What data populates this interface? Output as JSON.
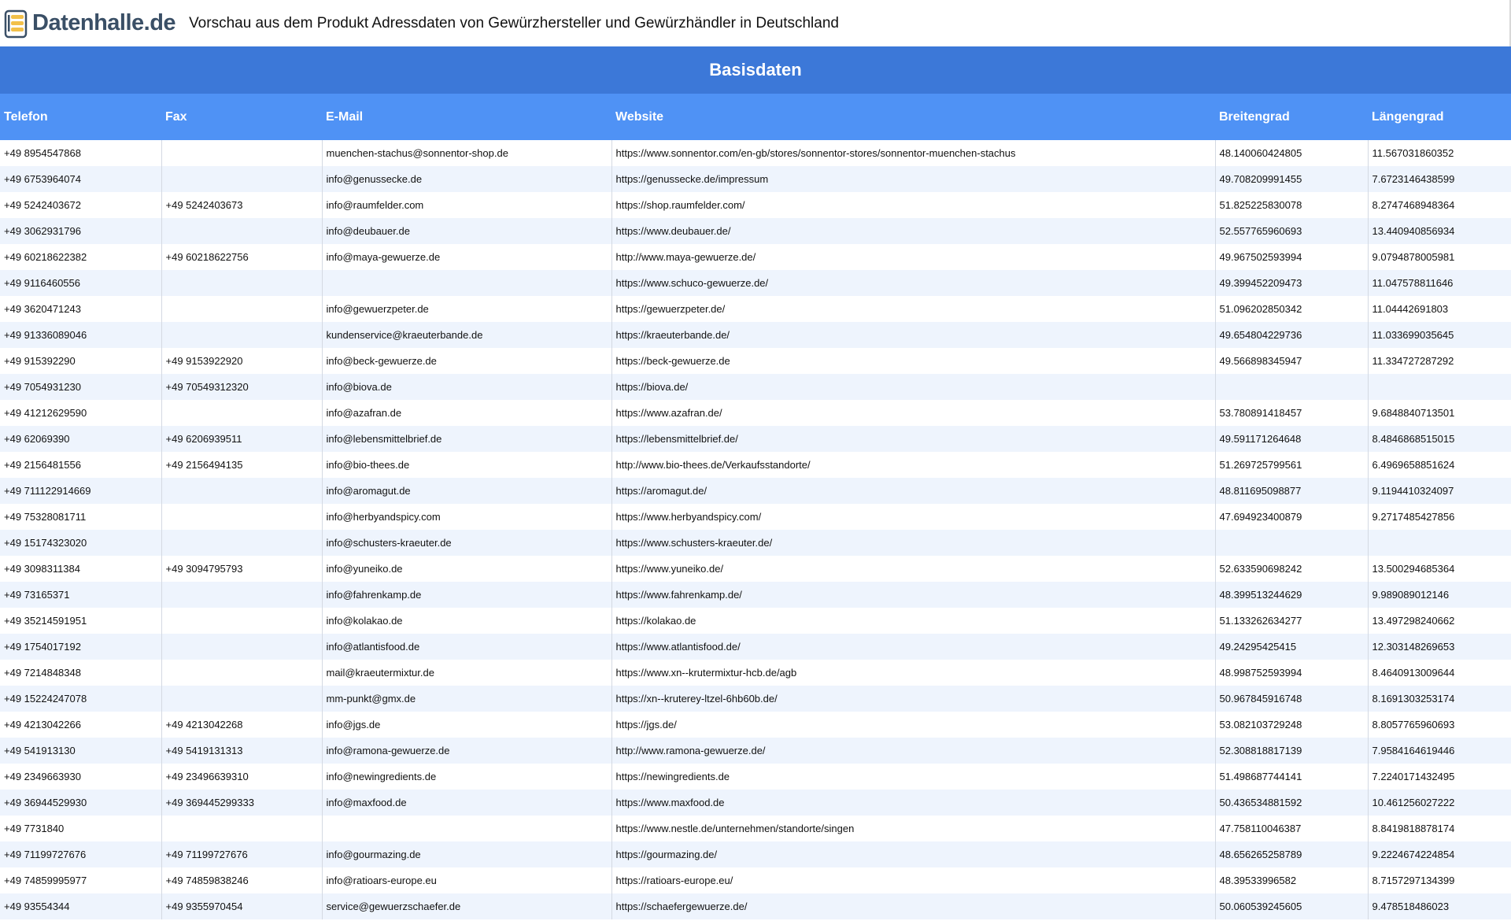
{
  "header": {
    "logo_text": "Datenhalle.de",
    "title": "Vorschau aus dem Produkt Adressdaten von Gewürzhersteller und Gewürzhändler in Deutschland"
  },
  "section": {
    "title": "Basisdaten"
  },
  "table": {
    "columns": [
      "Telefon",
      "Fax",
      "E-Mail",
      "Website",
      "Breitengrad",
      "Längengrad"
    ],
    "rows": [
      [
        "+49 8954547868",
        "",
        "muenchen-stachus@sonnentor-shop.de",
        "https://www.sonnentor.com/en-gb/stores/sonnentor-stores/sonnentor-muenchen-stachus",
        "48.140060424805",
        "11.567031860352"
      ],
      [
        "+49 6753964074",
        "",
        "info@genussecke.de",
        "https://genussecke.de/impressum",
        "49.708209991455",
        "7.6723146438599"
      ],
      [
        "+49 5242403672",
        "+49 5242403673",
        "info@raumfelder.com",
        "https://shop.raumfelder.com/",
        "51.825225830078",
        "8.2747468948364"
      ],
      [
        "+49 3062931796",
        "",
        "info@deubauer.de",
        "https://www.deubauer.de/",
        "52.557765960693",
        "13.440940856934"
      ],
      [
        "+49 60218622382",
        "+49 60218622756",
        "info@maya-gewuerze.de",
        "http://www.maya-gewuerze.de/",
        "49.967502593994",
        "9.0794878005981"
      ],
      [
        "+49 9116460556",
        "",
        "",
        "https://www.schuco-gewuerze.de/",
        "49.399452209473",
        "11.047578811646"
      ],
      [
        "+49 3620471243",
        "",
        "info@gewuerzpeter.de",
        "https://gewuerzpeter.de/",
        "51.096202850342",
        "11.04442691803"
      ],
      [
        "+49 91336089046",
        "",
        "kundenservice@kraeuterbande.de",
        "https://kraeuterbande.de/",
        "49.654804229736",
        "11.033699035645"
      ],
      [
        "+49 915392290",
        "+49 9153922920",
        "info@beck-gewuerze.de",
        "https://beck-gewuerze.de",
        "49.566898345947",
        "11.334727287292"
      ],
      [
        "+49 7054931230",
        "+49 70549312320",
        "info@biova.de",
        "https://biova.de/",
        "",
        ""
      ],
      [
        "+49 41212629590",
        "",
        "info@azafran.de",
        "https://www.azafran.de/",
        "53.780891418457",
        "9.6848840713501"
      ],
      [
        "+49 62069390",
        "+49 6206939511",
        "info@lebensmittelbrief.de",
        "https://lebensmittelbrief.de/",
        "49.591171264648",
        "8.4846868515015"
      ],
      [
        "+49 2156481556",
        "+49 2156494135",
        "info@bio-thees.de",
        "http://www.bio-thees.de/Verkaufsstandorte/",
        "51.269725799561",
        "6.4969658851624"
      ],
      [
        "+49 711122914669",
        "",
        "info@aromagut.de",
        "https://aromagut.de/",
        "48.811695098877",
        "9.1194410324097"
      ],
      [
        "+49 75328081711",
        "",
        "info@herbyandspicy.com",
        "https://www.herbyandspicy.com/",
        "47.694923400879",
        "9.2717485427856"
      ],
      [
        "+49 15174323020",
        "",
        "info@schusters-kraeuter.de",
        "https://www.schusters-kraeuter.de/",
        "",
        ""
      ],
      [
        "+49 3098311384",
        "+49 3094795793",
        "info@yuneiko.de",
        "https://www.yuneiko.de/",
        "52.633590698242",
        "13.500294685364"
      ],
      [
        "+49 73165371",
        "",
        "info@fahrenkamp.de",
        "https://www.fahrenkamp.de/",
        "48.399513244629",
        "9.989089012146"
      ],
      [
        "+49 35214591951",
        "",
        "info@kolakao.de",
        "https://kolakao.de",
        "51.133262634277",
        "13.497298240662"
      ],
      [
        "+49 1754017192",
        "",
        "info@atlantisfood.de",
        "https://www.atlantisfood.de/",
        "49.24295425415",
        "12.303148269653"
      ],
      [
        "+49 7214848348",
        "",
        "mail@kraeutermixtur.de",
        "https://www.xn--krutermixtur-hcb.de/agb",
        "48.998752593994",
        "8.4640913009644"
      ],
      [
        "+49 15224247078",
        "",
        "mm-punkt@gmx.de",
        "https://xn--kruterey-ltzel-6hb60b.de/",
        "50.967845916748",
        "8.1691303253174"
      ],
      [
        "+49 4213042266",
        "+49 4213042268",
        "info@jgs.de",
        "https://jgs.de/",
        "53.082103729248",
        "8.8057765960693"
      ],
      [
        "+49 541913130",
        "+49 5419131313",
        "info@ramona-gewuerze.de",
        "http://www.ramona-gewuerze.de/",
        "52.308818817139",
        "7.9584164619446"
      ],
      [
        "+49 2349663930",
        "+49 23496639310",
        "info@newingredients.de",
        "https://newingredients.de",
        "51.498687744141",
        "7.2240171432495"
      ],
      [
        "+49 36944529930",
        "+49 369445299333",
        "info@maxfood.de",
        "https://www.maxfood.de",
        "50.436534881592",
        "10.461256027222"
      ],
      [
        "+49 7731840",
        "",
        "",
        "https://www.nestle.de/unternehmen/standorte/singen",
        "47.758110046387",
        "8.8419818878174"
      ],
      [
        "+49 71199727676",
        "+49 71199727676",
        "info@gourmazing.de",
        "https://gourmazing.de/",
        "48.656265258789",
        "9.2224674224854"
      ],
      [
        "+49 74859995977",
        "+49 74859838246",
        "info@ratioars-europe.eu",
        "https://ratioars-europe.eu/",
        "48.39533996582",
        "8.7157297134399"
      ],
      [
        "+49 93554344",
        "+49 9355970454",
        "service@gewuerzschaefer.de",
        "https://schaefergewuerze.de/",
        "50.060539245605",
        "9.478518486023"
      ]
    ]
  },
  "colors": {
    "section_header_bg": "#3c78d8",
    "column_header_bg": "#4f92f5",
    "row_alt_bg": "#eef4fd",
    "logo_text": "#3a4f66"
  }
}
